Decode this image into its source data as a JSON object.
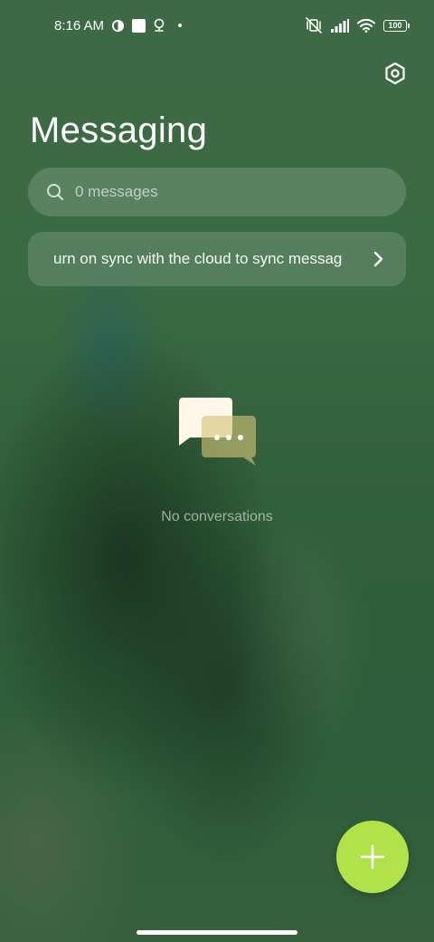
{
  "status_bar": {
    "time": "8:16 AM",
    "battery": "100",
    "icons": [
      "clock-c-icon",
      "square-notification-icon",
      "location-pin-icon",
      "dot-icon",
      "vibrate-muted-icon",
      "signal-icon",
      "wifi-icon",
      "battery-icon"
    ]
  },
  "header": {
    "title": "Messaging",
    "settings_icon": "settings-gear-icon"
  },
  "search": {
    "placeholder": "0 messages",
    "icon": "search-icon"
  },
  "sync_banner": {
    "text": "urn on sync with the cloud to sync messag",
    "icon": "chevron-right-icon"
  },
  "empty_state": {
    "text": "No conversations",
    "icon": "chat-bubbles-icon"
  },
  "fab": {
    "label": "+",
    "color": "#b2e24a"
  },
  "colors": {
    "accent": "#b2e24a",
    "background": "#305f3a"
  }
}
